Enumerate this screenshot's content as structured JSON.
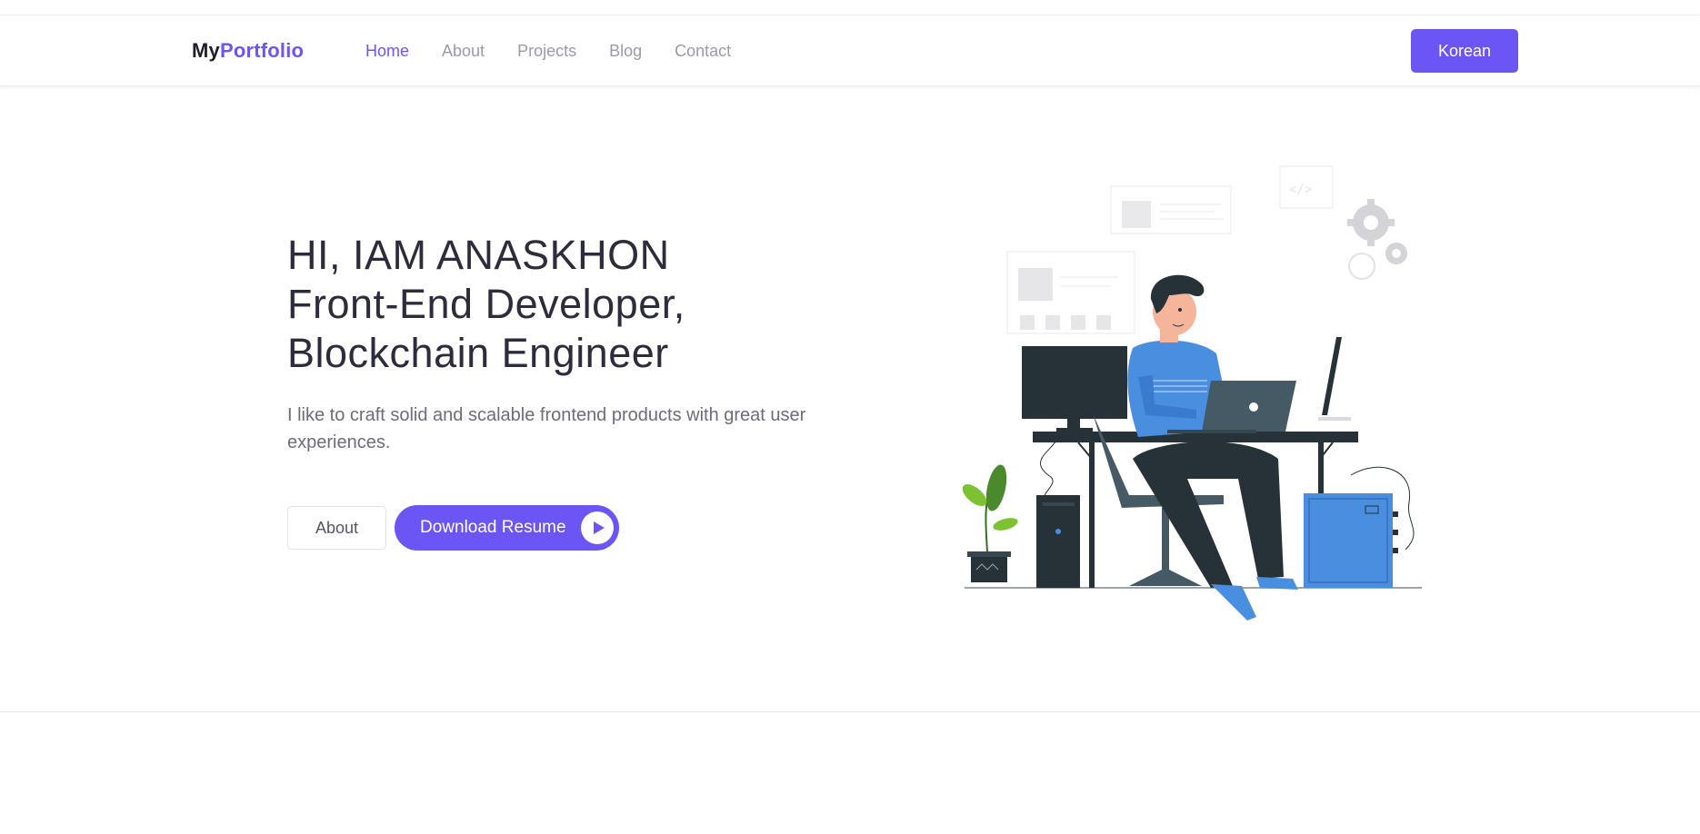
{
  "brand": {
    "prefix": "My",
    "accent": "Portfolio"
  },
  "nav": {
    "items": [
      {
        "label": "Home",
        "active": true
      },
      {
        "label": "About",
        "active": false
      },
      {
        "label": "Projects",
        "active": false
      },
      {
        "label": "Blog",
        "active": false
      },
      {
        "label": "Contact",
        "active": false
      }
    ],
    "language_button": "Korean"
  },
  "hero": {
    "title_lines": [
      "HI, IAM ANASKHON",
      "Front-End Developer,",
      "Blockchain Engineer"
    ],
    "description": "I like to craft solid and scalable frontend products with great user experiences.",
    "about_button": "About",
    "resume_button": "Download Resume",
    "resume_icon": "play-icon",
    "illustration": "developer-at-desk-illustration"
  },
  "colors": {
    "accent": "#6c55f5",
    "text_dark": "#2c2c3c",
    "text_muted": "#9a9aa8",
    "illustration_blue": "#4a8ee0"
  }
}
